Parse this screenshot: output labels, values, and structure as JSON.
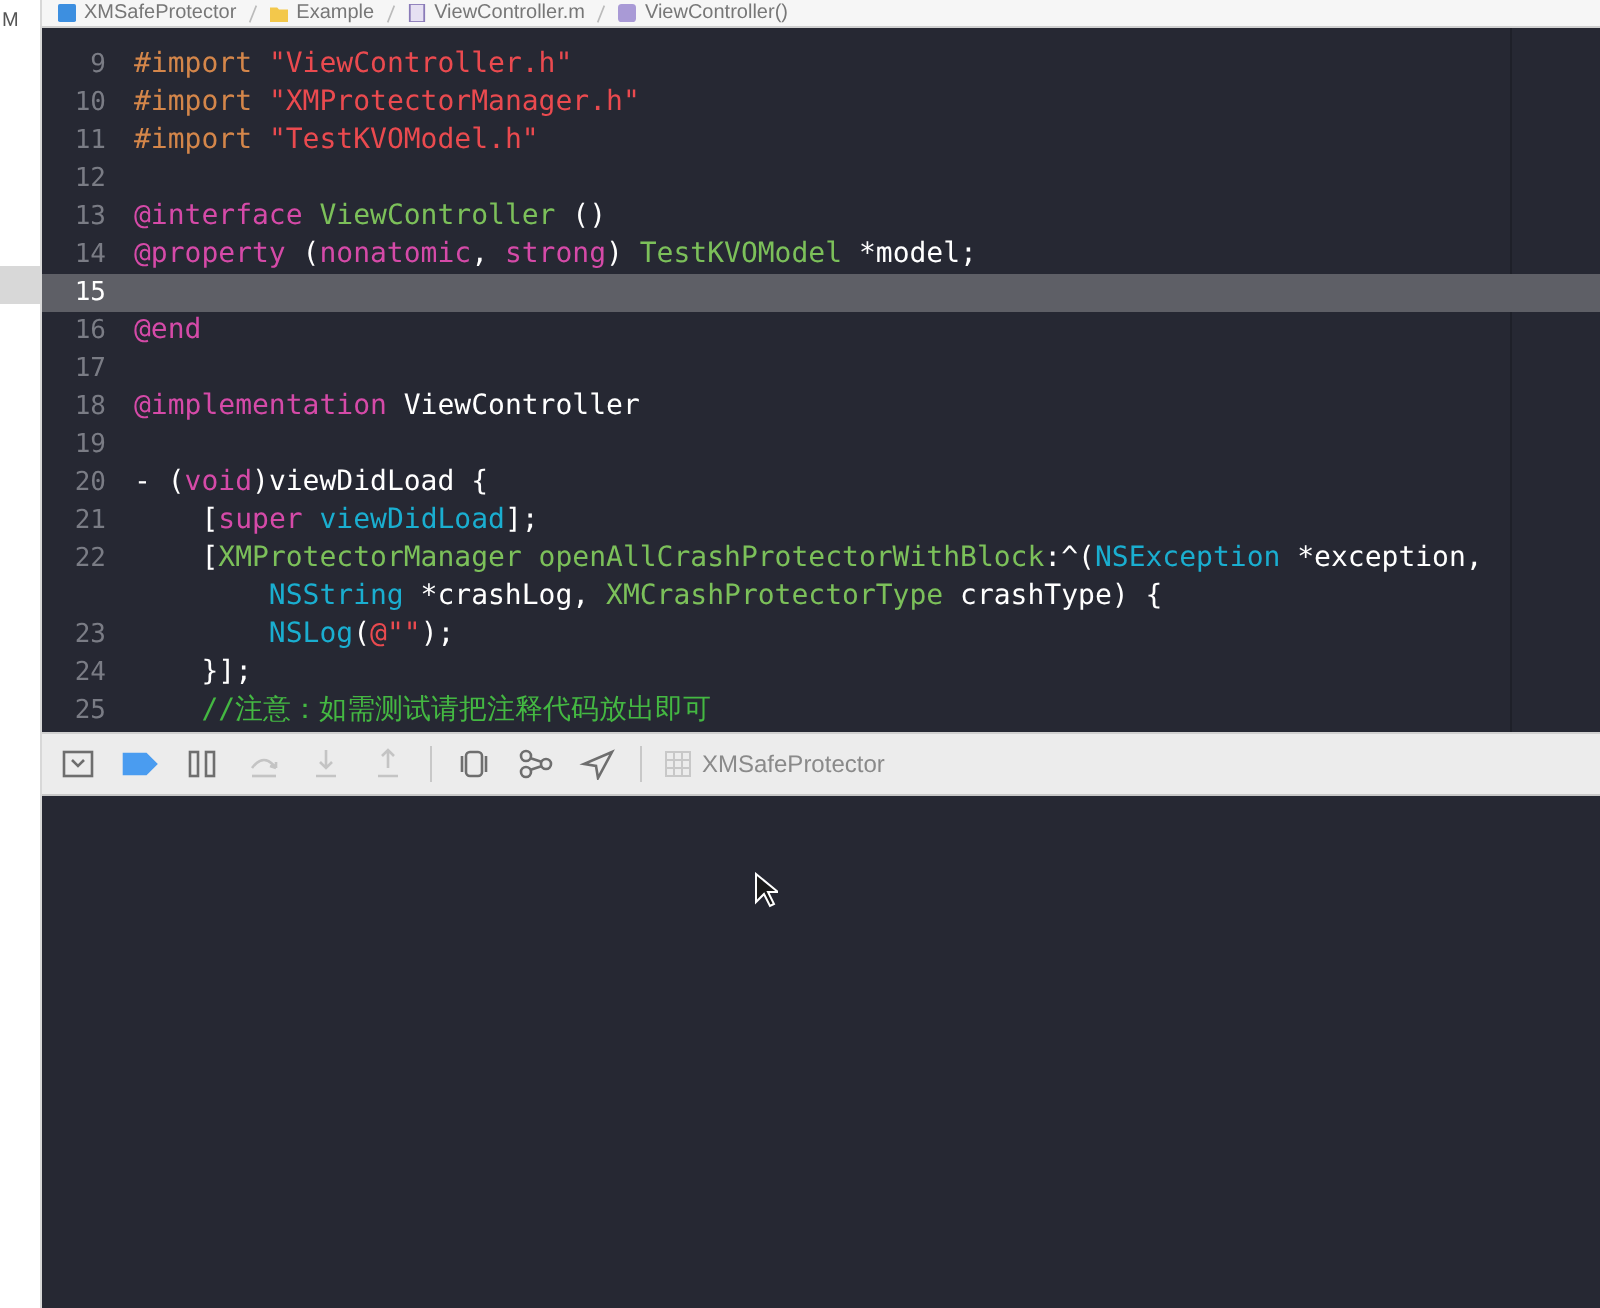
{
  "sidebar": {
    "text": "M"
  },
  "jump_bar": {
    "items": [
      {
        "kind": "project",
        "label": "XMSafeProtector"
      },
      {
        "kind": "folder",
        "label": "Example"
      },
      {
        "kind": "file",
        "label": "ViewController.m"
      },
      {
        "kind": "symbol",
        "label": "ViewController()"
      }
    ]
  },
  "editor": {
    "lines": [
      {
        "number": "9",
        "current": false,
        "tokens": [
          {
            "kind": "preproc",
            "text": "#import"
          },
          {
            "kind": "string",
            "text": " \"ViewController.h\""
          }
        ]
      },
      {
        "number": "10",
        "current": false,
        "tokens": [
          {
            "kind": "preproc",
            "text": "#import"
          },
          {
            "kind": "string",
            "text": " \"XMProtectorManager.h\""
          }
        ]
      },
      {
        "number": "11",
        "current": false,
        "tokens": [
          {
            "kind": "preproc",
            "text": "#import"
          },
          {
            "kind": "string",
            "text": " \"TestKVOModel.h\""
          }
        ]
      },
      {
        "number": "12",
        "current": false
      },
      {
        "number": "13",
        "current": false,
        "tokens": [
          {
            "kind": "keyword",
            "text": "@interface"
          },
          {
            "kind": "project",
            "text": " ViewController"
          },
          {
            "kind": "plain",
            "text": " ()"
          }
        ]
      },
      {
        "number": "14",
        "current": false,
        "tokens": [
          {
            "kind": "keyword",
            "text": "@property"
          },
          {
            "kind": "plain",
            "text": " ("
          },
          {
            "kind": "keyword",
            "text": "nonatomic"
          },
          {
            "kind": "plain",
            "text": ", "
          },
          {
            "kind": "keyword",
            "text": "strong"
          },
          {
            "kind": "plain",
            "text": ") "
          },
          {
            "kind": "project",
            "text": "TestKVOModel"
          },
          {
            "kind": "plain",
            "text": " *model;"
          }
        ]
      },
      {
        "number": "15",
        "current": true
      },
      {
        "number": "16",
        "current": false,
        "tokens": [
          {
            "kind": "keyword",
            "text": "@end"
          }
        ]
      },
      {
        "number": "17",
        "current": false
      },
      {
        "number": "18",
        "current": false,
        "tokens": [
          {
            "kind": "keyword",
            "text": "@implementation"
          },
          {
            "kind": "plain",
            "text": " ViewController"
          }
        ]
      },
      {
        "number": "19",
        "current": false
      },
      {
        "number": "20",
        "current": false,
        "tokens": [
          {
            "kind": "plain",
            "text": "- ("
          },
          {
            "kind": "keyword",
            "text": "void"
          },
          {
            "kind": "plain",
            "text": ")viewDidLoad {"
          }
        ]
      },
      {
        "number": "21",
        "current": false,
        "tokens": [
          {
            "kind": "plain",
            "text": "    ["
          },
          {
            "kind": "keyword",
            "text": "super"
          },
          {
            "kind": "system",
            "text": " viewDidLoad"
          },
          {
            "kind": "plain",
            "text": "];"
          }
        ]
      },
      {
        "number": "22",
        "current": false,
        "tokens": [
          {
            "kind": "plain",
            "text": "    ["
          },
          {
            "kind": "project",
            "text": "XMProtectorManager openAllCrashProtectorWithBlock"
          },
          {
            "kind": "plain",
            "text": ":^("
          },
          {
            "kind": "system",
            "text": "NSException"
          },
          {
            "kind": "plain",
            "text": " *exception,"
          }
        ]
      },
      {
        "current": false,
        "tokens": [
          {
            "kind": "system",
            "text": "        NSString"
          },
          {
            "kind": "plain",
            "text": " *crashLog, "
          },
          {
            "kind": "project",
            "text": "XMCrashProtectorType"
          },
          {
            "kind": "plain",
            "text": " crashType) {"
          }
        ]
      },
      {
        "number": "23",
        "current": false,
        "tokens": [
          {
            "kind": "system",
            "text": "        NSLog"
          },
          {
            "kind": "plain",
            "text": "("
          },
          {
            "kind": "string",
            "text": "@\"\""
          },
          {
            "kind": "plain",
            "text": ");"
          }
        ]
      },
      {
        "number": "24",
        "current": false,
        "tokens": [
          {
            "kind": "plain",
            "text": "    }];"
          }
        ]
      },
      {
        "number": "25",
        "current": false,
        "tokens": [
          {
            "kind": "comment",
            "text": "    //注意：如需测试请把注释代码放出即可"
          }
        ]
      }
    ]
  },
  "debug_bar": {
    "items": [
      {
        "kind": "hide",
        "disabled": false
      },
      {
        "kind": "breakpoints",
        "on": true,
        "disabled": false
      },
      {
        "kind": "pause",
        "disabled": false
      },
      {
        "kind": "step-over",
        "disabled": true
      },
      {
        "kind": "step-in",
        "disabled": true
      },
      {
        "kind": "step-out",
        "disabled": true
      },
      {
        "kind": "separator"
      },
      {
        "kind": "view-debug",
        "disabled": false
      },
      {
        "kind": "memory",
        "disabled": false
      },
      {
        "kind": "location",
        "disabled": false
      },
      {
        "kind": "separator"
      },
      {
        "kind": "target",
        "label": "XMSafeProtector",
        "disabled": false
      }
    ]
  }
}
